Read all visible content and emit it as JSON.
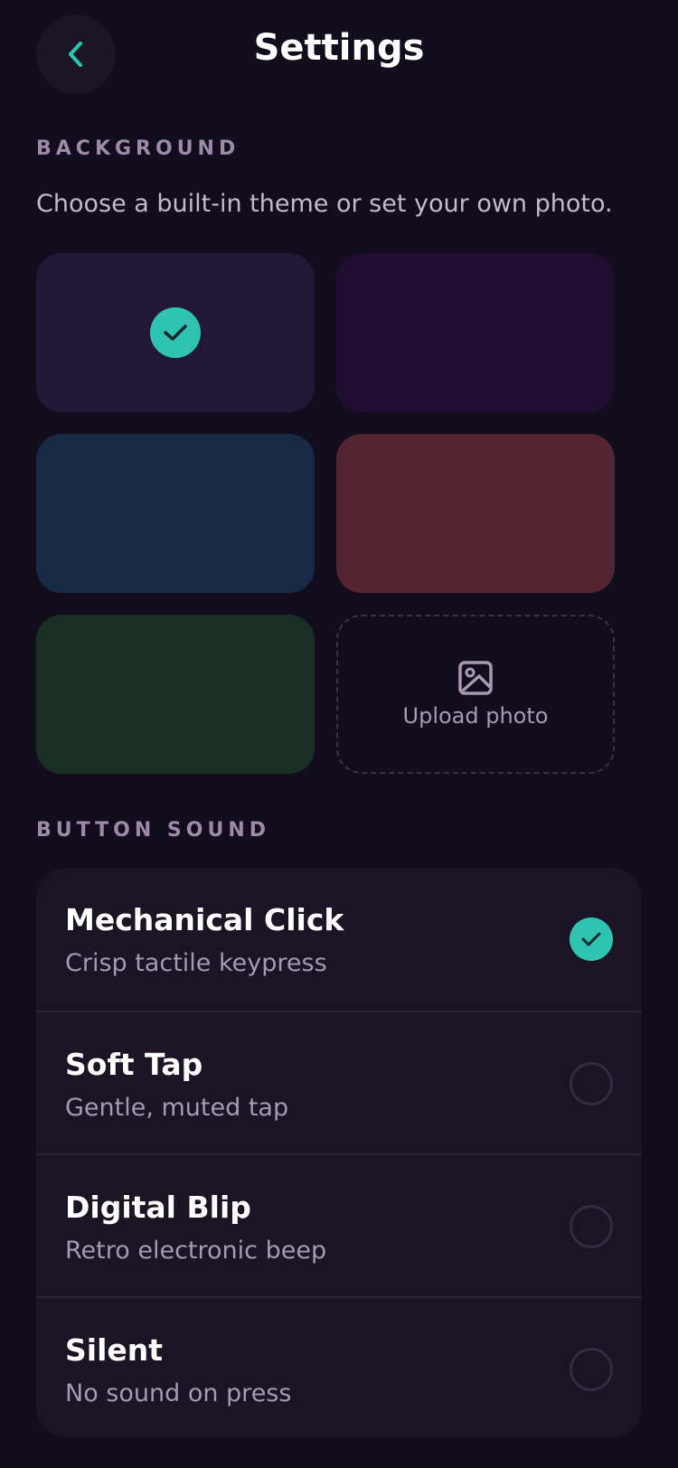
{
  "header": {
    "title": "Settings",
    "back_icon": "chevron-left-icon",
    "accent": "#2ec4b1"
  },
  "background": {
    "section_label": "BACKGROUND",
    "subtitle": "Choose a built-in theme or set your own photo.",
    "themes": [
      {
        "color": "#211836",
        "selected": true
      },
      {
        "color": "#200d30",
        "selected": false
      },
      {
        "color": "#172a45",
        "selected": false
      },
      {
        "color": "#532532",
        "selected": false
      },
      {
        "color": "#192e24",
        "selected": false
      }
    ],
    "upload_label": "Upload photo",
    "upload_icon": "image-icon"
  },
  "button_sound": {
    "section_label": "BUTTON SOUND",
    "options": [
      {
        "name": "Mechanical Click",
        "description": "Crisp tactile keypress",
        "selected": true
      },
      {
        "name": "Soft Tap",
        "description": "Gentle, muted tap",
        "selected": false
      },
      {
        "name": "Digital Blip",
        "description": "Retro electronic beep",
        "selected": false
      },
      {
        "name": "Silent",
        "description": "No sound on press",
        "selected": false
      }
    ]
  }
}
